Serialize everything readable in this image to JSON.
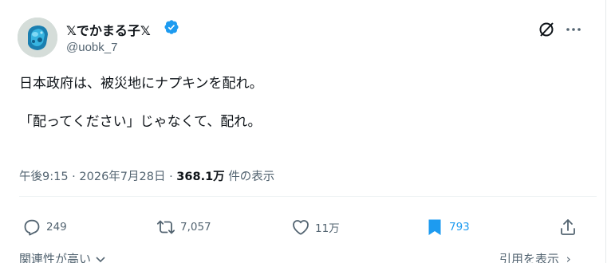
{
  "author": {
    "display_name": "𝕏でかまる子𝕏",
    "handle": "@uobk_7",
    "verified": true
  },
  "tweet": {
    "text": "日本政府は、被災地にナプキンを配れ。\n\n「配ってください」じゃなくて、配れ。"
  },
  "meta": {
    "time": "午後9:15",
    "date": "2026年7月28日",
    "views_count": "368.1万",
    "views_label": "件の表示"
  },
  "actions": {
    "replies": "249",
    "reposts": "7,057",
    "likes": "11万",
    "bookmarks": "793"
  },
  "footer": {
    "sort_label": "関連性が高い",
    "quote_label": "引用を表示"
  },
  "colors": {
    "text": "#0f1419",
    "secondary": "#536471",
    "accent": "#1d9bf0"
  },
  "icons": [
    "verified-badge-icon",
    "grok-icon",
    "more-icon",
    "reply-icon",
    "repost-icon",
    "like-icon",
    "bookmark-icon",
    "share-icon",
    "chevron-down-icon"
  ]
}
